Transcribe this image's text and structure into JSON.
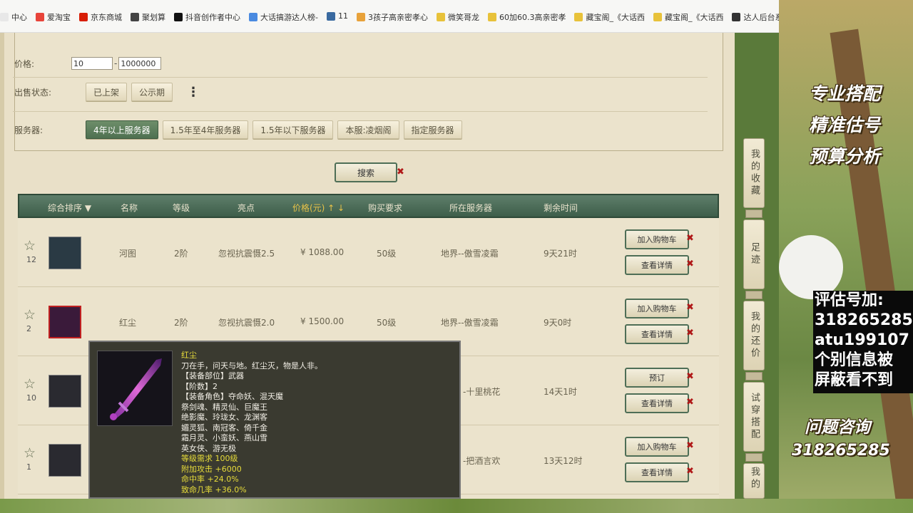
{
  "bookmarks": [
    {
      "label": "中心",
      "color": "#e8e8e8"
    },
    {
      "label": "爱淘宝",
      "color": "#e8443a"
    },
    {
      "label": "京东商城",
      "color": "#d81e06"
    },
    {
      "label": "聚划算",
      "color": "#444"
    },
    {
      "label": "抖音创作者中心",
      "color": "#111"
    },
    {
      "label": "大话搞游达人榜-",
      "color": "#4a8ae0"
    },
    {
      "label": "11",
      "color": "#3a6aa0"
    },
    {
      "label": "3孩子高亲密孝心",
      "color": "#e8a23a"
    },
    {
      "label": "微笑哥龙",
      "color": "#e8c23a"
    },
    {
      "label": "60加60.3高亲密孝",
      "color": "#e8c23a"
    },
    {
      "label": "藏宝阁_《大话西",
      "color": "#e8c23a"
    },
    {
      "label": "藏宝阁_《大话西",
      "color": "#e8c23a"
    },
    {
      "label": "达人后台系",
      "color": "#333"
    }
  ],
  "filters": {
    "price_label": "价格:",
    "price_min": "10",
    "price_max": "1000000",
    "price_dash": "-",
    "sale_status_label": "出售状态:",
    "sale_status_options": [
      "已上架",
      "公示期"
    ],
    "more": "⋮",
    "server_label": "服务器:",
    "server_options": [
      "4年以上服务器",
      "1.5年至4年服务器",
      "1.5年以下服务器",
      "本服:凌烟阁",
      "指定服务器"
    ],
    "server_active": 0
  },
  "search_label": "搜索",
  "table": {
    "headers": {
      "sort": "综合排序 ▼",
      "name": "名称",
      "level": "等级",
      "highlight": "亮点",
      "price": "价格(元) ↑ ↓",
      "requirement": "购买要求",
      "server": "所在服务器",
      "time_left": "剩余时间"
    },
    "rows": [
      {
        "fav_count": "12",
        "name": "河图",
        "level": "2阶",
        "highlight": "忽视抗震慑2.5",
        "price": "¥ 1088.00",
        "requirement": "50级",
        "server": "地界--傲雪凌霜",
        "time_left": "9天21时",
        "btn1": "加入购物车",
        "btn2": "查看详情"
      },
      {
        "fav_count": "2",
        "name": "红尘",
        "level": "2阶",
        "highlight": "忽视抗震慑2.0",
        "price": "¥ 1500.00",
        "requirement": "50级",
        "server": "地界--傲雪凌霜",
        "time_left": "9天0时",
        "btn1": "加入购物车",
        "btn2": "查看详情"
      },
      {
        "fav_count": "10",
        "name": "",
        "level": "",
        "highlight": "",
        "price": "",
        "requirement": "",
        "server": "-十里桃花",
        "time_left": "14天1时",
        "btn1": "预订",
        "btn2": "查看详情"
      },
      {
        "fav_count": "1",
        "name": "",
        "level": "",
        "highlight": "",
        "price": "",
        "requirement": "",
        "server": "-把酒言欢",
        "time_left": "13天12时",
        "btn1": "加入购物车",
        "btn2": "查看详情"
      }
    ]
  },
  "tooltip": {
    "name": "红尘",
    "desc": "刀在手，问天与地。红尘灭，物是人非。",
    "slot": "【装备部位】武器",
    "tier": "【阶数】2",
    "roles_title": "【装备角色】夺命妖、混天魔",
    "roles": [
      "祭剑魂、精灵仙、巨魔王",
      "绝影魔、玲珑女、龙渊客",
      "媚灵狐、南冠客、倚千金",
      "霜月灵、小蛮妖、燕山雪",
      "英女侠、游无极"
    ],
    "level_req": "等级需求 100级",
    "attack": "附加攻击 +6000",
    "hit": "命中率 +24.0%",
    "crit": "致命几率 +36.0%"
  },
  "right_nav": [
    "我的收藏",
    "足迹",
    "我的还价",
    "试穿搭配",
    "我的"
  ],
  "overlay": {
    "line1": "专业搭配",
    "line2": "精准估号",
    "line3": "预算分析",
    "info": [
      "评估号加:",
      "318265285",
      "atu199107",
      "个别信息被",
      "屏蔽看不到"
    ],
    "consult": "问题咨询",
    "consult_number": "318265285"
  }
}
